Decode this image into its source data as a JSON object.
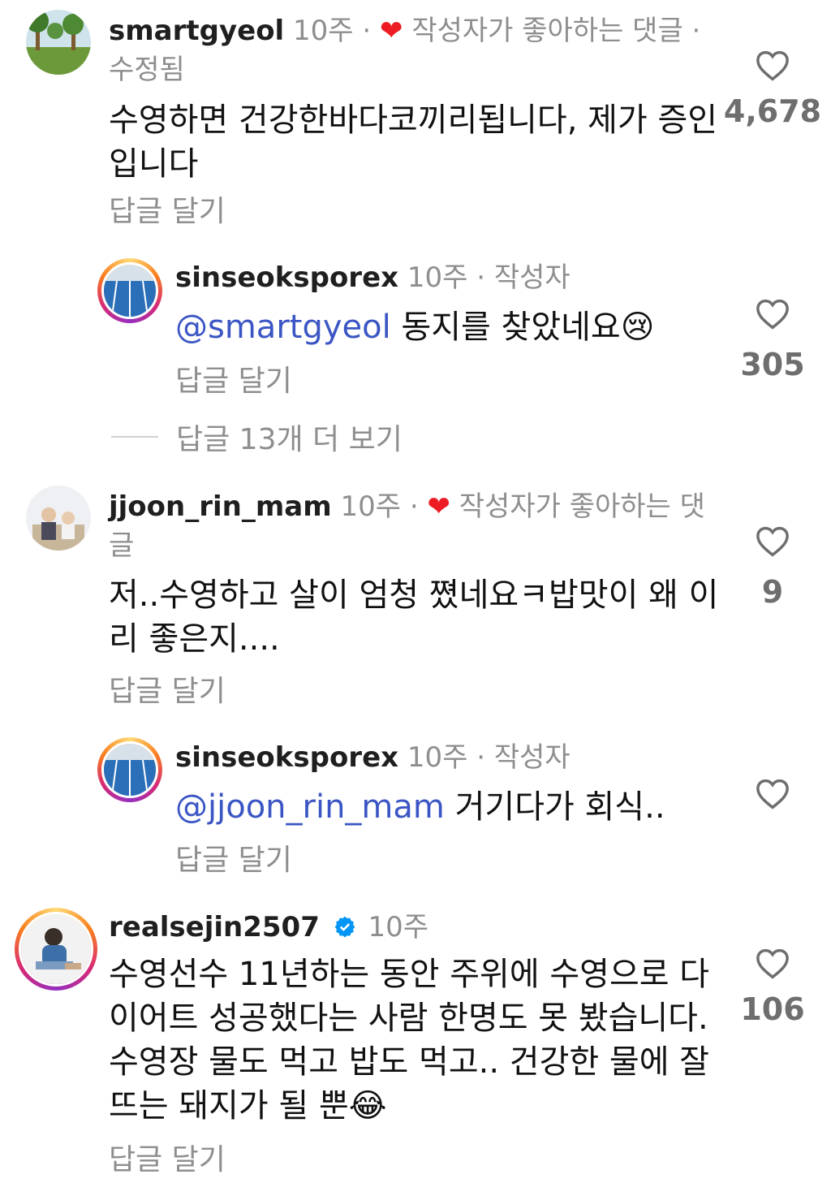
{
  "comments": [
    {
      "username": "smartgyeol",
      "time": "10주",
      "sep": "·",
      "badge": "작성자가 좋아하는 댓글",
      "edited": "· 수정됨",
      "text": "수영하면 건강한바다코끼리됩니다, 제가 증인입니다",
      "reply_label": "답글 달기",
      "likes": "4,678"
    },
    {
      "username": "sinseoksporex",
      "time": "10주",
      "role": "· 작성자",
      "mention": "@smartgyeol",
      "text": "동지를 찾았네요",
      "emoji": "😢",
      "reply_label": "답글 달기",
      "likes": "305"
    },
    {
      "username": "jjoon_rin_mam",
      "time": "10주",
      "sep": "·",
      "badge": "작성자가 좋아하는 댓글",
      "text": "저..수영하고 살이 엄청 쪘네요ㅋ밥맛이 왜 이리 좋은지....",
      "reply_label": "답글 달기",
      "likes": "9"
    },
    {
      "username": "sinseoksporex",
      "time": "10주",
      "role": "· 작성자",
      "mention": "@jjoon_rin_mam",
      "text": "거기다가 회식..",
      "reply_label": "답글 달기",
      "likes": ""
    },
    {
      "username": "realsejin2507",
      "time": "10주",
      "text": "수영선수 11년하는 동안 주위에 수영으로 다이어트 성공했다는 사람 한명도 못 봤습니다. 수영장 물도 먹고 밥도 먹고.. 건강한 물에 잘 뜨는 돼지가 될 뿐",
      "emoji": "😂",
      "reply_label": "답글 달기",
      "likes": "106"
    }
  ],
  "view_more_replies": "답글 13개 더 보기",
  "icons": {
    "heart_outline": "heart-outline-icon",
    "heart_filled": "heart-filled-icon",
    "verified": "verified-badge-icon"
  },
  "colors": {
    "mention": "#3b56c4",
    "liked_heart": "#ed1c24",
    "verified": "#0095f6"
  }
}
